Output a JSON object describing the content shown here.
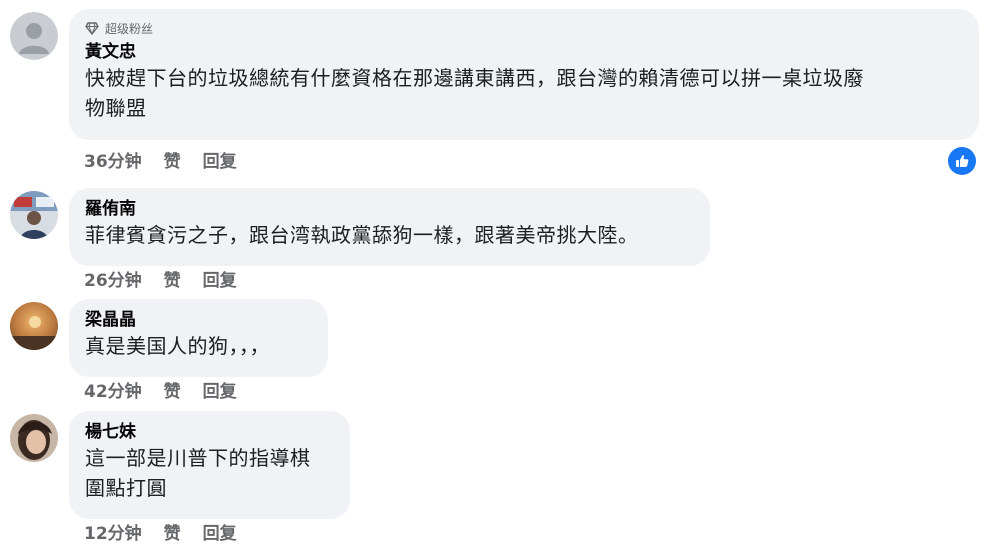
{
  "comments": [
    {
      "badge": "超级粉丝",
      "author": "黃文忠",
      "text_line1": "快被趕下台的垃圾總統有什麼資格在那邊講東講西，跟台灣的賴清德可以拼一桌垃圾廢",
      "text_line2": "物聯盟",
      "time": "36分钟",
      "like": "赞",
      "reply": "回复"
    },
    {
      "author": "羅侑南",
      "text_line1": "菲律賓貪污之子，跟台湾執政黨舔狗一樣，跟著美帝挑大陸。",
      "time": "26分钟",
      "like": "赞",
      "reply": "回复"
    },
    {
      "author": "梁晶晶",
      "text_line1": "真是美国人的狗，，，",
      "time": "42分钟",
      "like": "赞",
      "reply": "回复"
    },
    {
      "author": "楊七妹",
      "text_line1": "這一部是川普下的指導棋",
      "text_line2": "圍點打圓",
      "time": "12分钟",
      "like": "赞",
      "reply": "回复"
    }
  ],
  "icons": {
    "badge_icon": "diamond-icon",
    "reaction_icon": "thumbs-up-icon"
  },
  "colors": {
    "bubble": "#f0f2f5",
    "like_blue": "#1877f2",
    "meta_gray": "#65676b"
  }
}
